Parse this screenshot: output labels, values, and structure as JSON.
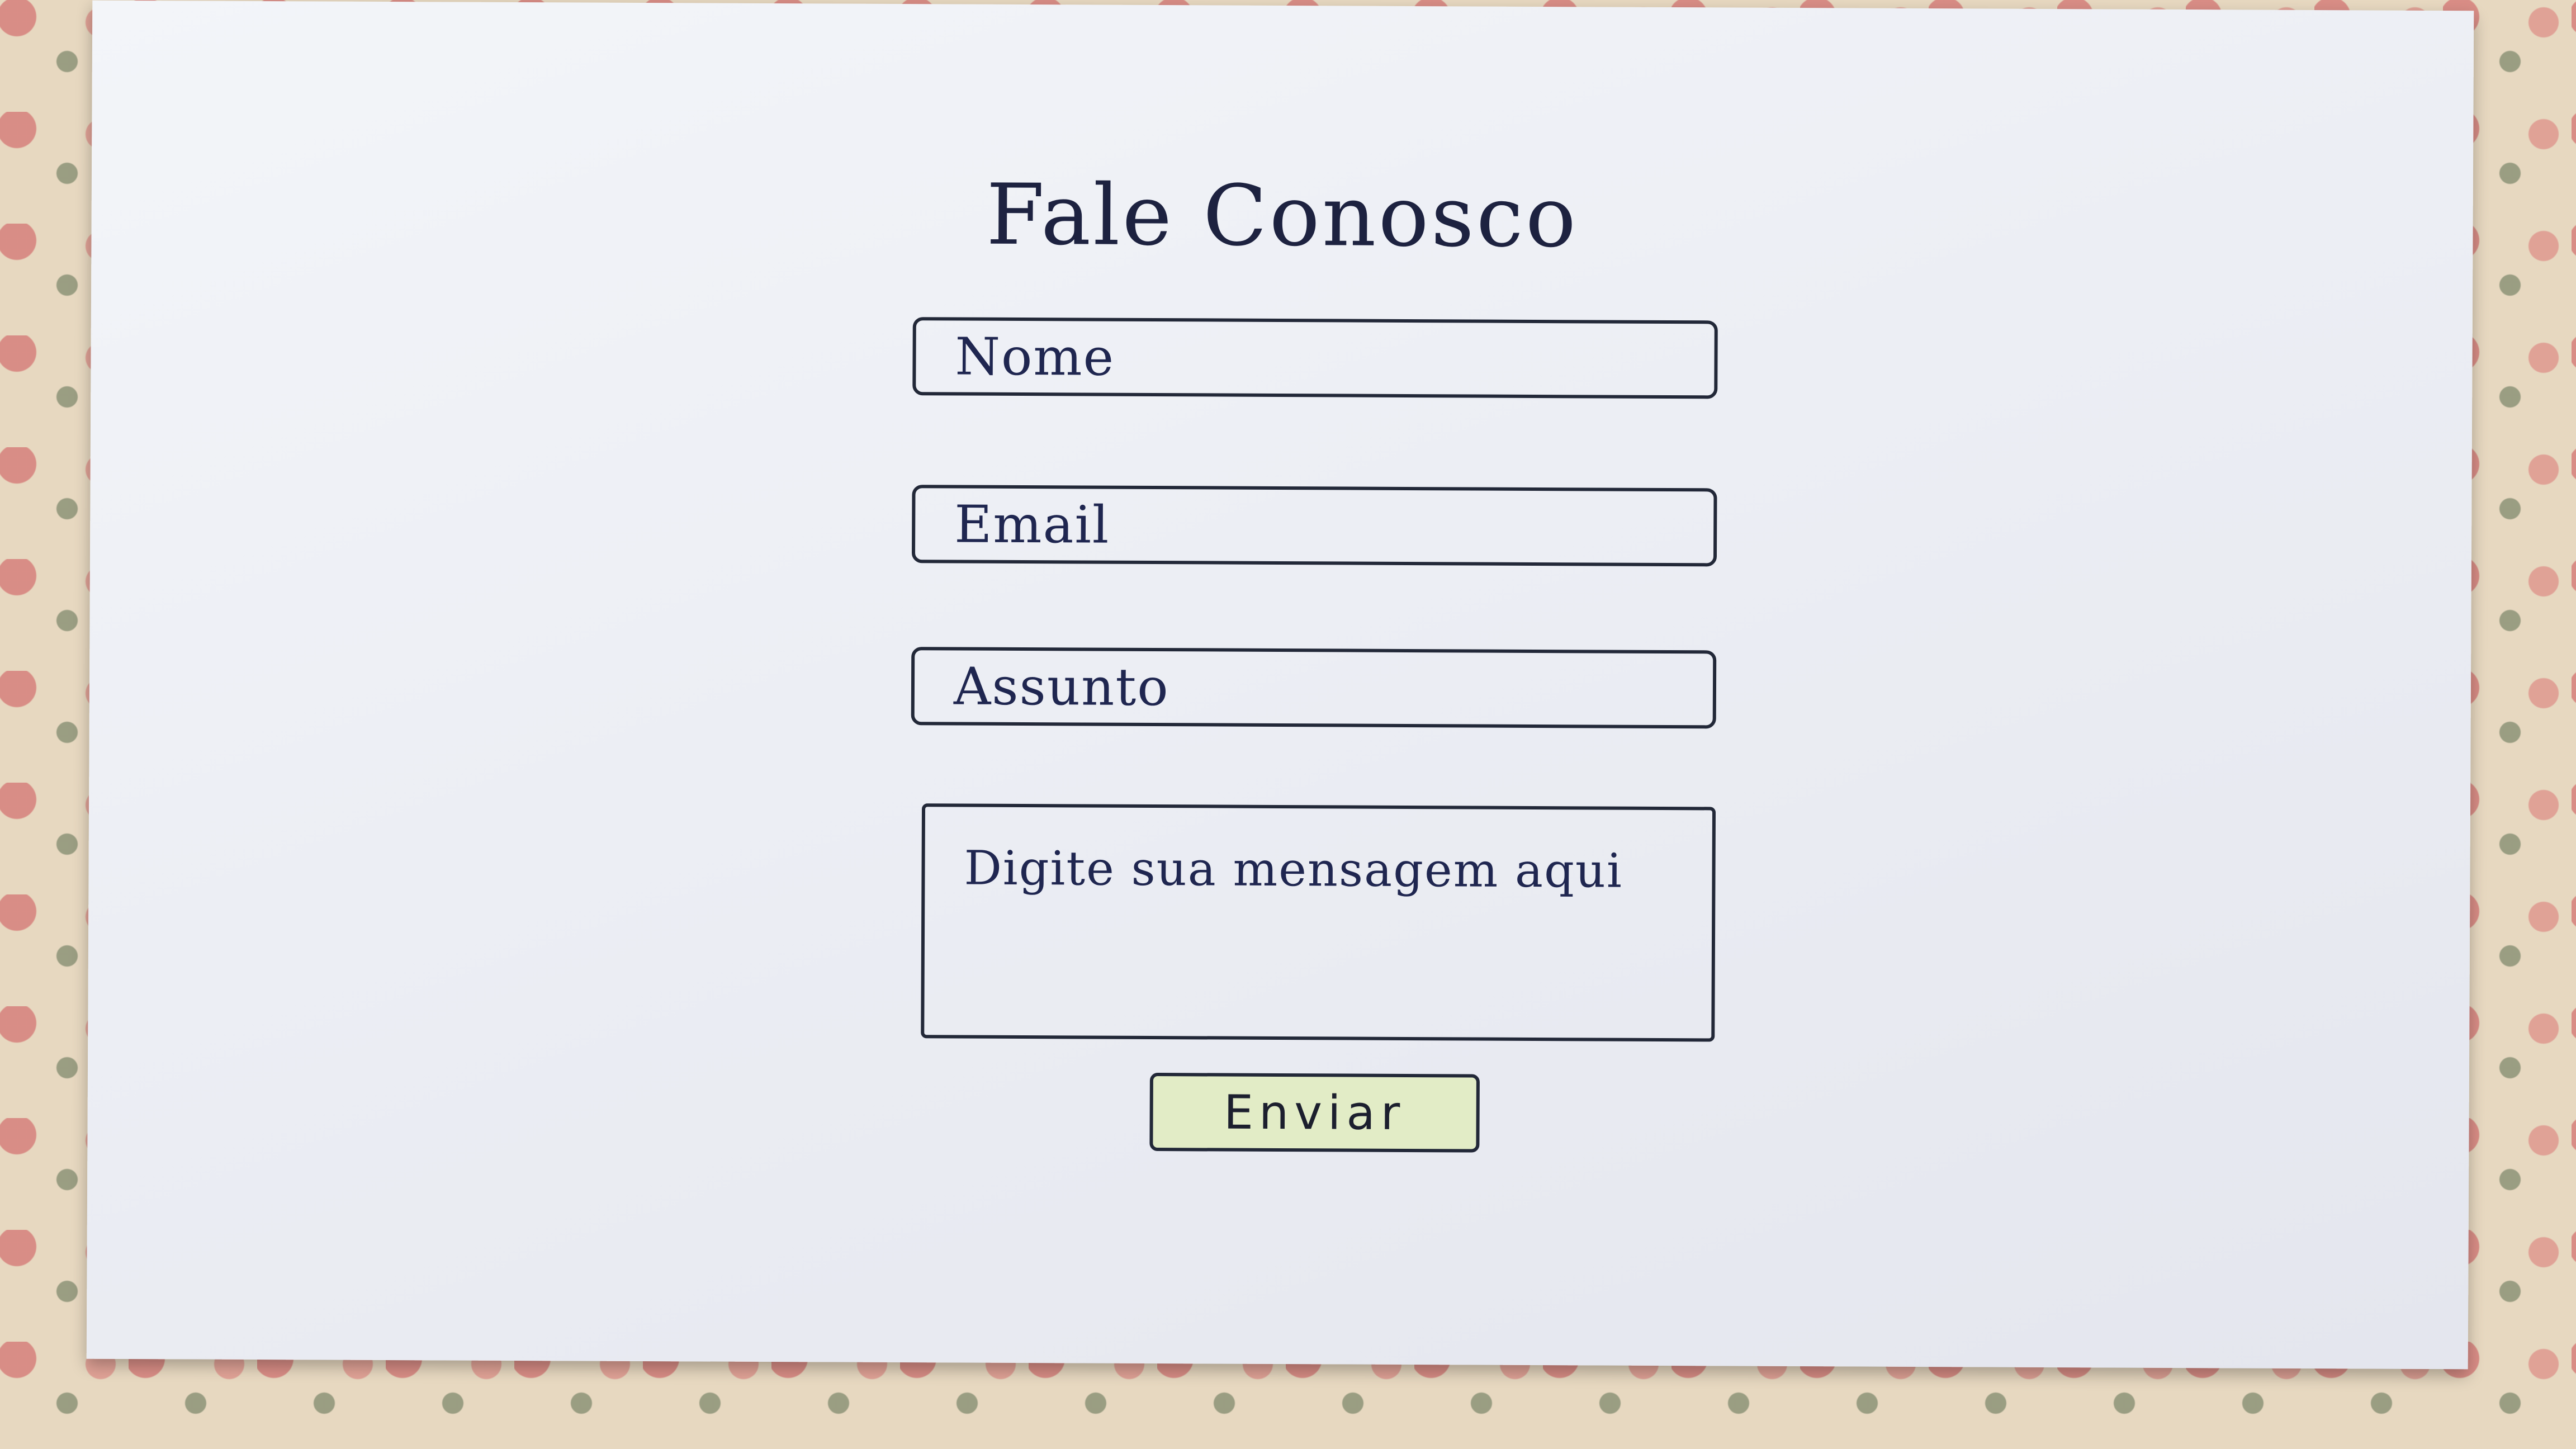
{
  "form": {
    "title": "Fale Conosco",
    "fields": {
      "nome": {
        "placeholder": "Nome"
      },
      "email": {
        "placeholder": "Email"
      },
      "assunto": {
        "placeholder": "Assunto"
      },
      "mensagem": {
        "placeholder": "Digite sua mensagem aqui"
      }
    },
    "submit_label": "Enviar"
  },
  "colors": {
    "ink": "#1f2650",
    "button_fill": "#e2ecc6",
    "paper": "#eceef4"
  }
}
